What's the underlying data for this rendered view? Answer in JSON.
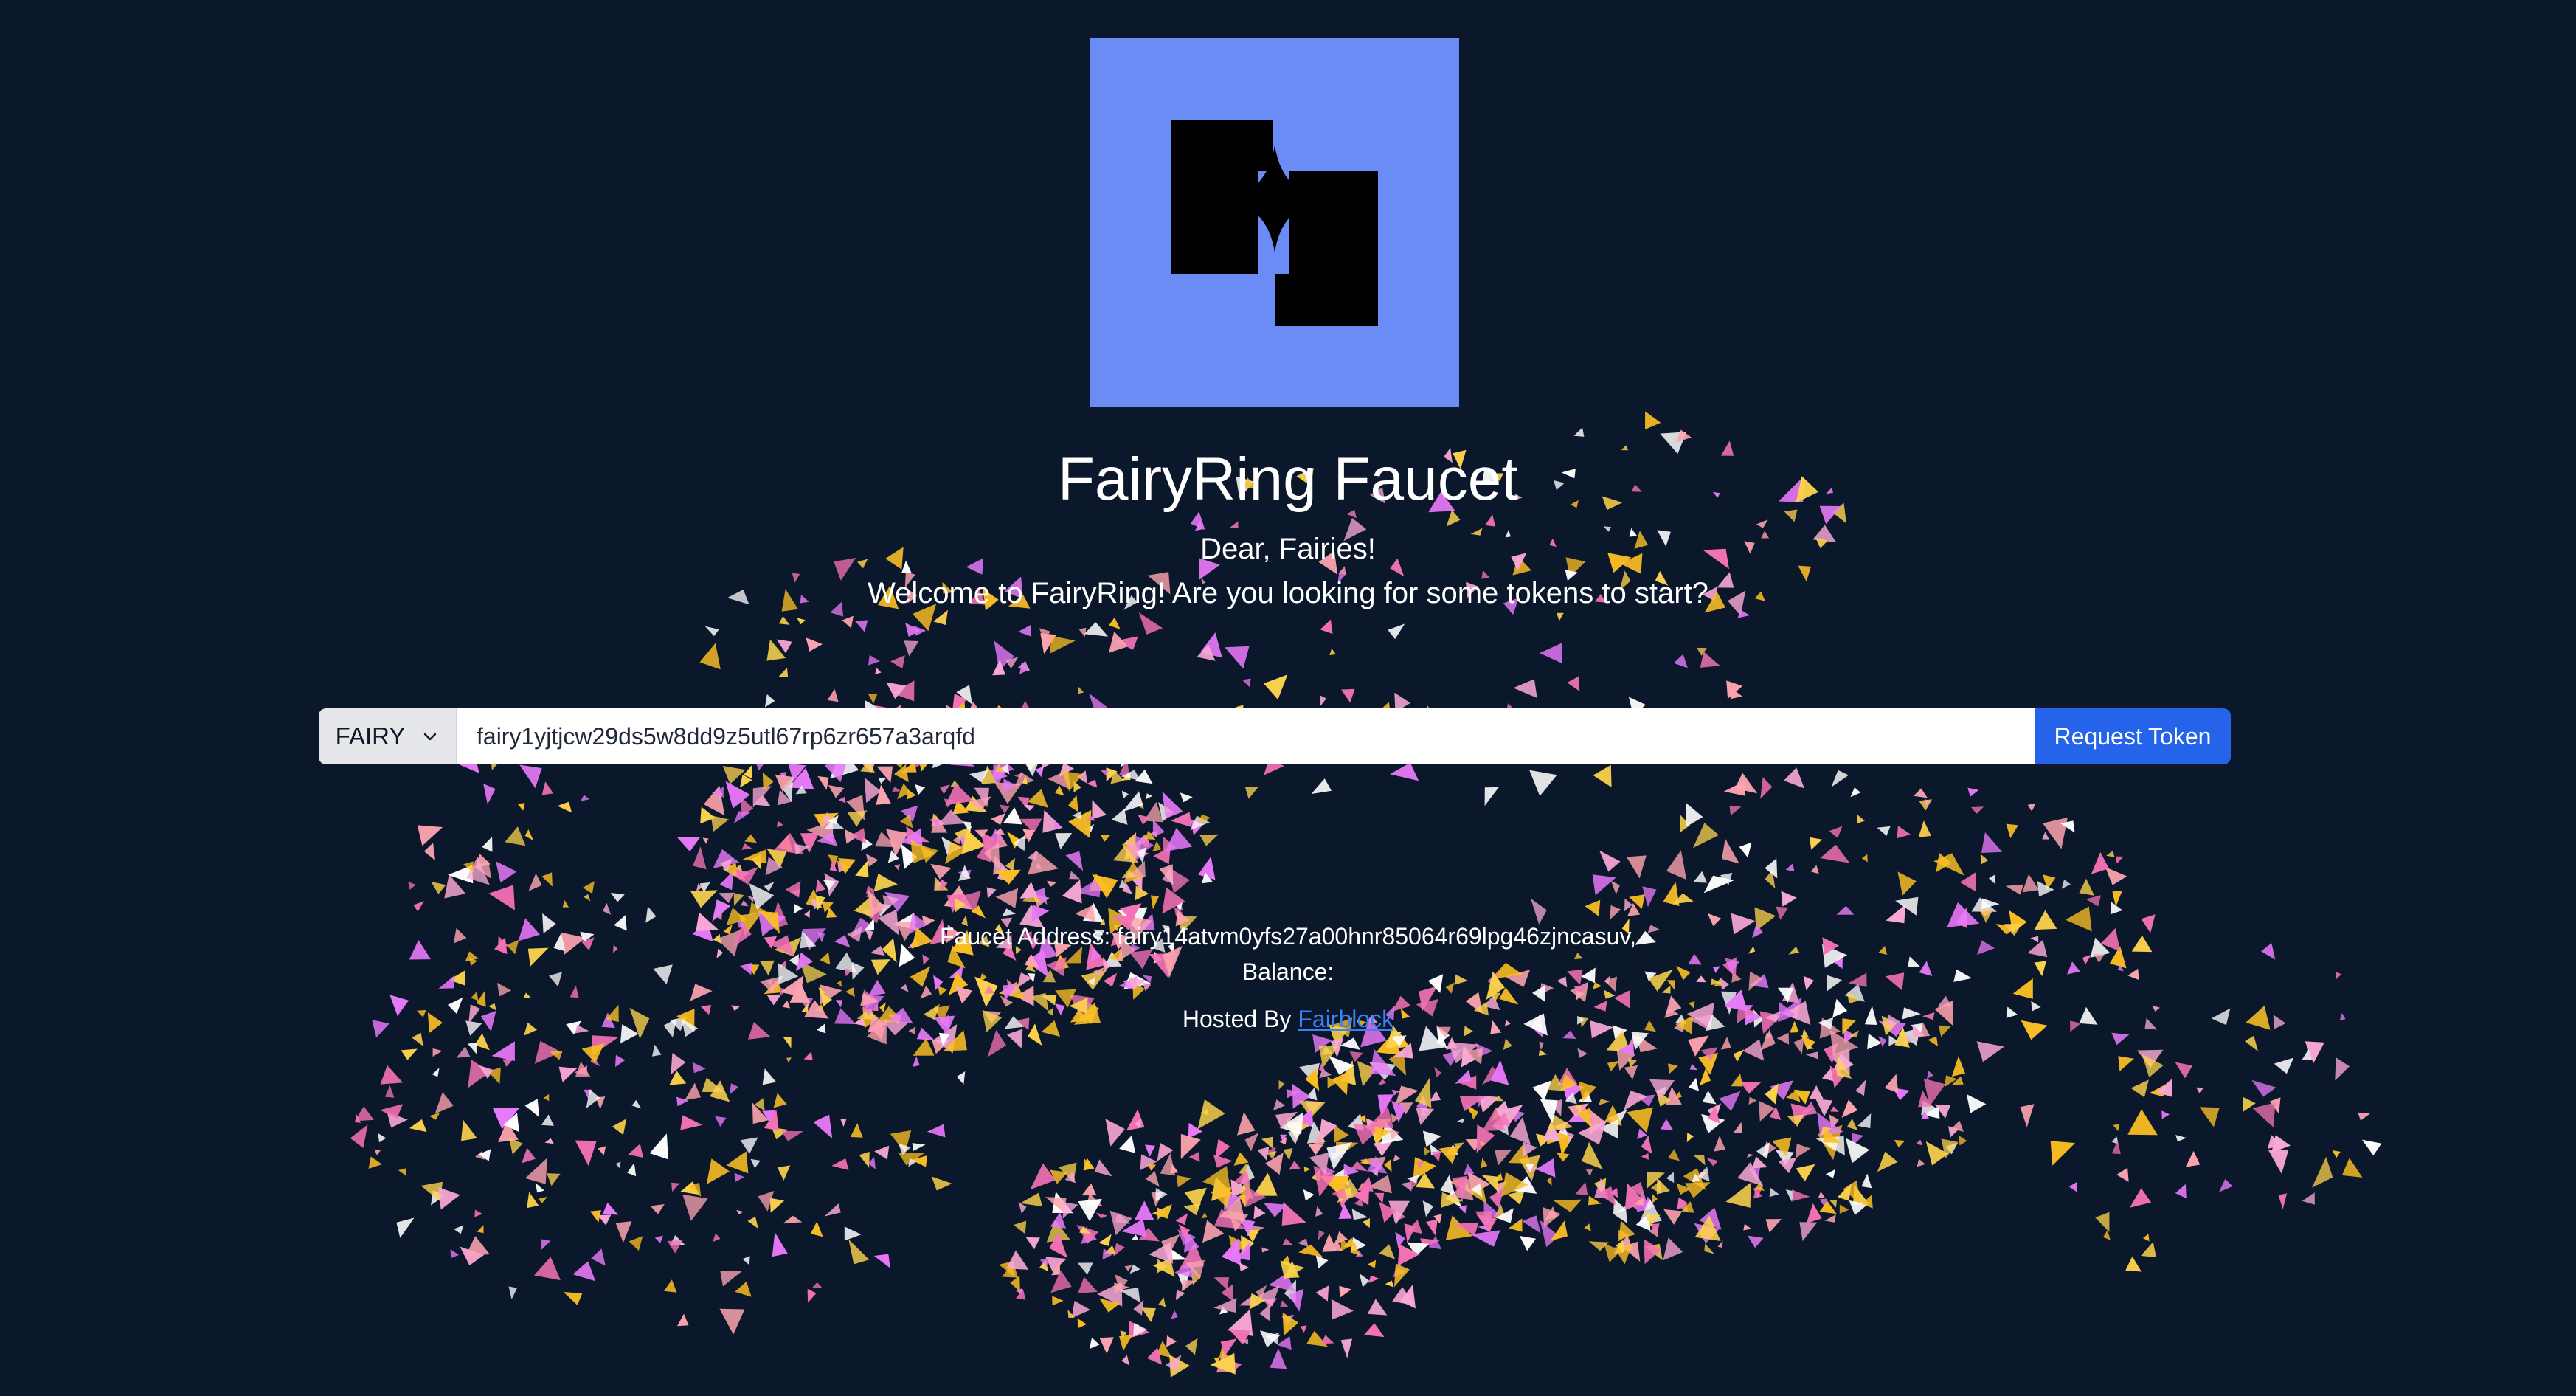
{
  "logo": {
    "alt": "FairyRing logo",
    "background": "#6b8cf5",
    "icon": "fairyring-logo"
  },
  "title": "FairyRing Faucet",
  "greeting": "Dear, Fairies!",
  "welcome": "Welcome to FairyRing! Are you looking for some tokens to start?",
  "form": {
    "denom": "FAIRY",
    "address_value": "fairy1yjtjcw29ds5w8dd9z5utl67rp6zr657a3arqfd",
    "request_label": "Request Token"
  },
  "faucet": {
    "address_line": "Faucet Address: fairy14atvm0yfs27a00hnr85064r69lpg46zjncasuv,",
    "balance_line": "Balance:"
  },
  "footer": {
    "hosted_by": "Hosted By",
    "link_label": "Fairblock"
  },
  "colors": {
    "background": "#0b172a",
    "accent": "#2563eb",
    "confetti": [
      "#f472b6",
      "#e879f9",
      "#fbbf24",
      "#fda4af",
      "#fcd34d",
      "#f9a8d4",
      "#ffffff"
    ]
  }
}
